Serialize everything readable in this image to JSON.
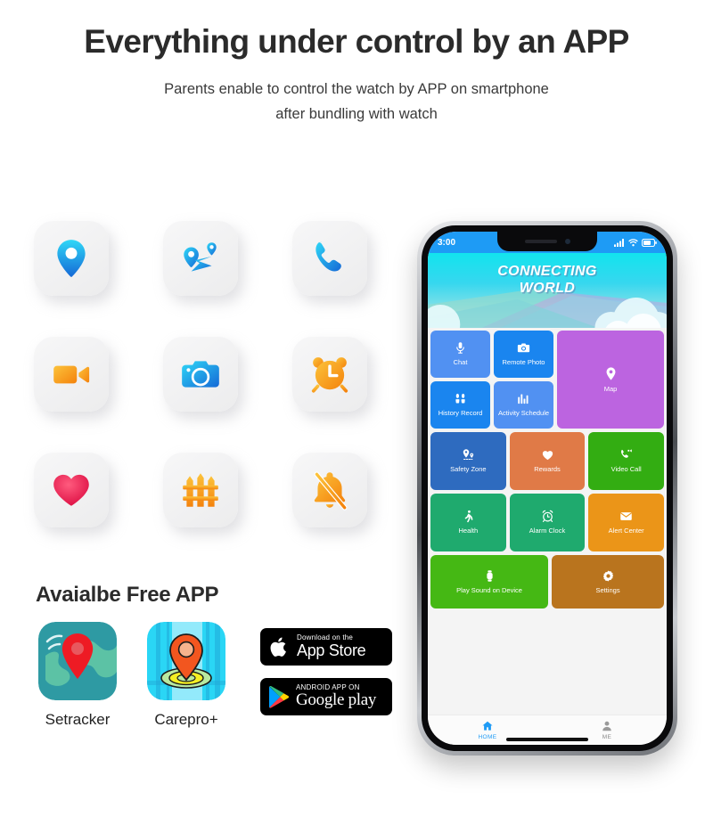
{
  "header": {
    "headline": "Everything under control by an APP",
    "subline_1": "Parents enable to control the watch by APP on smartphone",
    "subline_2": "after bundling with watch"
  },
  "feature_icons": [
    {
      "name": "location-pin-icon",
      "icon": "location-pin",
      "color": "#18b6f0"
    },
    {
      "name": "route-map-icon",
      "icon": "route-map",
      "color": "#18b6f0"
    },
    {
      "name": "phone-call-icon",
      "icon": "phone-call",
      "color": "#18b6f0"
    },
    {
      "name": "video-camera-icon",
      "icon": "video-camera",
      "color": "#f9a11b"
    },
    {
      "name": "photo-camera-icon",
      "icon": "photo-camera",
      "color": "#18b6f0"
    },
    {
      "name": "alarm-clock-icon",
      "icon": "alarm-clock",
      "color": "#f9a11b"
    },
    {
      "name": "heart-icon",
      "icon": "heart",
      "color": "#ee2b55"
    },
    {
      "name": "fence-icon",
      "icon": "fence",
      "color": "#f9a11b"
    },
    {
      "name": "bell-off-icon",
      "icon": "bell-off",
      "color": "#f9a11b"
    }
  ],
  "free_app": {
    "title": "Avaialbe Free APP",
    "apps": [
      {
        "label": "Setracker",
        "icon": "setracker-app-icon"
      },
      {
        "label": "Carepro+",
        "icon": "carepro-app-icon"
      }
    ],
    "badges": [
      {
        "name": "app-store-badge",
        "line1": "Download on the",
        "line2": "App Store"
      },
      {
        "name": "google-play-badge",
        "line1": "ANDROID APP ON",
        "line2": "Google play"
      }
    ]
  },
  "phone": {
    "status_bar": {
      "time": "3:00",
      "signal": "signal-icon",
      "wifi": "wifi-icon",
      "battery": "battery-icon"
    },
    "banner": {
      "line1": "CONNECTING",
      "line2": "WORLD"
    },
    "tiles": [
      {
        "label": "Chat",
        "icon": "microphone-icon",
        "color": "#5191f2"
      },
      {
        "label": "Remote Photo",
        "icon": "camera-icon",
        "color": "#1a85ef"
      },
      {
        "label": "Map",
        "icon": "map-pin-icon",
        "color": "#bc64e0"
      },
      {
        "label": "History Record",
        "icon": "footprints-icon",
        "color": "#1a85ef"
      },
      {
        "label": "Activity Schedule",
        "icon": "bar-chart-icon",
        "color": "#5191f2"
      },
      {
        "label": "Safety Zone",
        "icon": "geofence-pin-icon",
        "color": "#2e6bbf"
      },
      {
        "label": "Rewards",
        "icon": "heart-icon",
        "color": "#e07a47"
      },
      {
        "label": "Video Call",
        "icon": "call-video-icon",
        "color": "#33ad12"
      },
      {
        "label": "Health",
        "icon": "walking-icon",
        "color": "#1faa6e"
      },
      {
        "label": "Alarm Clock",
        "icon": "alarm-icon",
        "color": "#1faa6e"
      },
      {
        "label": "Alert Center",
        "icon": "envelope-icon",
        "color": "#eb9518"
      },
      {
        "label": "Play Sound on Device",
        "icon": "smartwatch-icon",
        "color": "#45b814"
      },
      {
        "label": "Settings",
        "icon": "gear-icon",
        "color": "#b9741e"
      }
    ],
    "tabs": [
      {
        "label": "HOME",
        "icon": "home-icon",
        "active": true
      },
      {
        "label": "ME",
        "icon": "person-icon",
        "active": false
      }
    ]
  }
}
